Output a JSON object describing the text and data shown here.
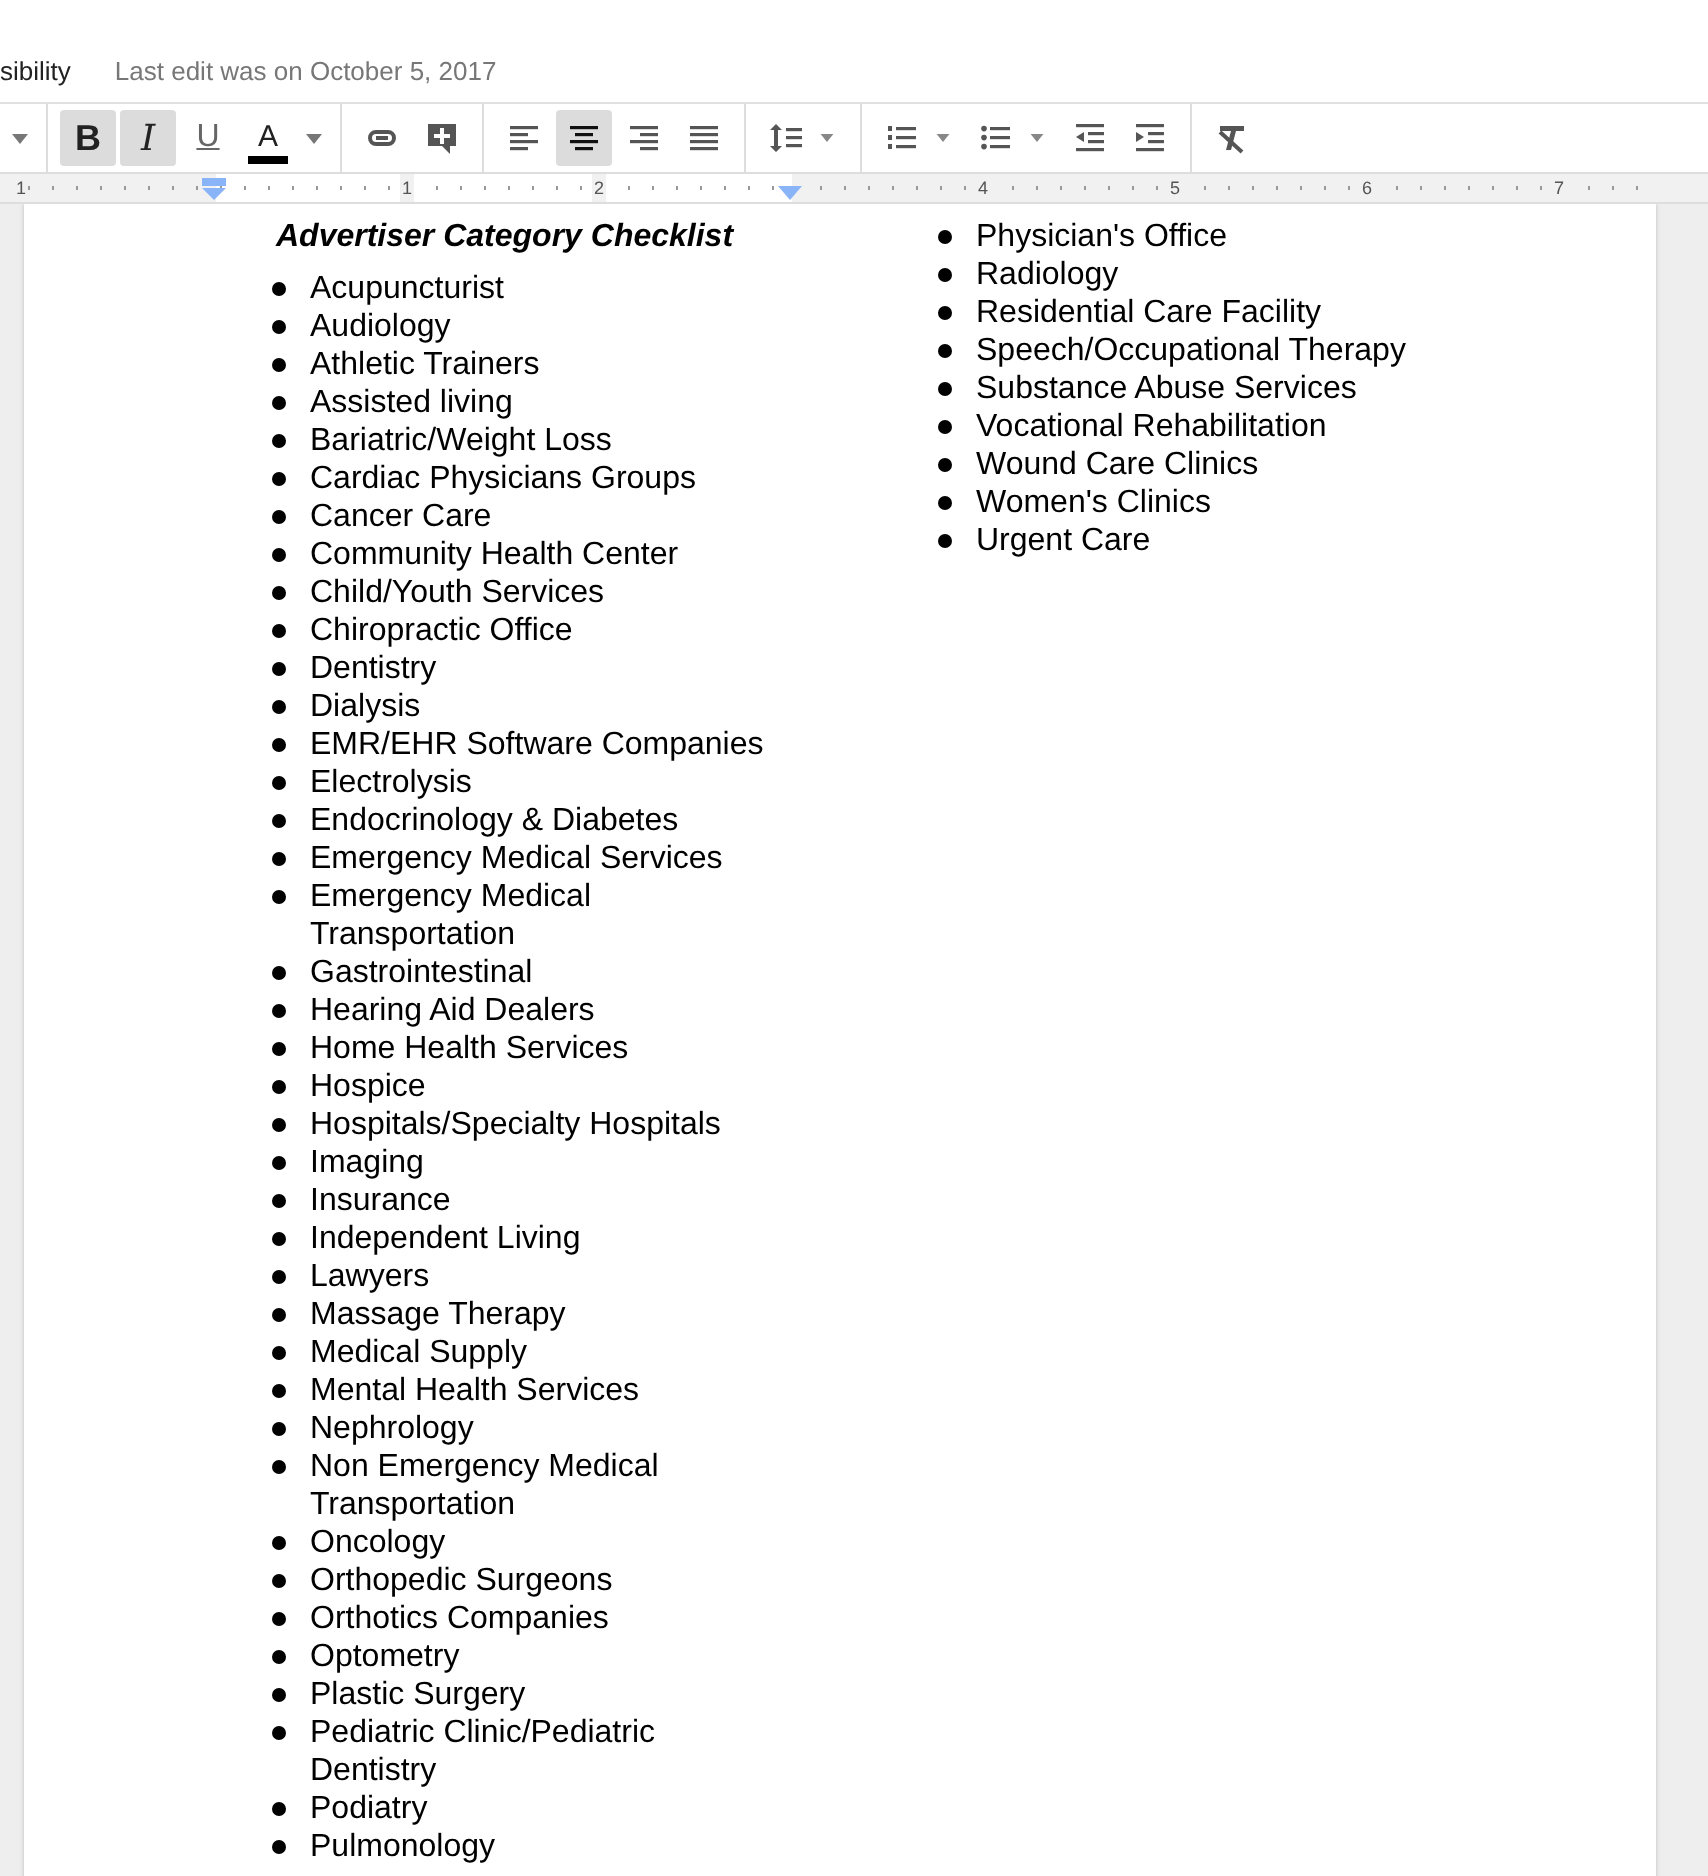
{
  "header": {
    "title": "sibility",
    "last_edit": "Last edit was on October 5, 2017"
  },
  "toolbar": {
    "text_style": [
      {
        "kind": "bold",
        "text": "B",
        "selected": true
      },
      {
        "kind": "italic",
        "text": "I",
        "selected": true
      },
      {
        "kind": "underline",
        "text": "U",
        "selected": false
      },
      {
        "kind": "color",
        "text": "A"
      }
    ],
    "align": [
      {
        "kind": "align-left",
        "selected": false
      },
      {
        "kind": "align-center",
        "selected": true
      },
      {
        "kind": "align-right",
        "selected": false
      },
      {
        "kind": "justify",
        "selected": false
      }
    ]
  },
  "ruler": {
    "labels": [
      "1",
      "1",
      "2",
      "4",
      "5",
      "6",
      "7"
    ]
  },
  "document": {
    "title": "Advertiser Category Checklist",
    "columns": [
      [
        "Acupuncturist",
        "Audiology",
        "Athletic Trainers",
        "Assisted living",
        "Bariatric/Weight Loss",
        "Cardiac Physicians Groups",
        "Cancer Care",
        "Community Health Center",
        "Child/Youth Services",
        "Chiropractic Office",
        "Dentistry",
        "Dialysis",
        "EMR/EHR Software Companies",
        "Electrolysis",
        "Endocrinology & Diabetes",
        "Emergency Medical Services",
        "Emergency Medical Transportation",
        "Gastrointestinal",
        "Hearing Aid Dealers",
        "Home Health Services",
        "Hospice",
        "Hospitals/Specialty Hospitals",
        "Imaging",
        "Insurance",
        "Independent Living",
        "Lawyers",
        "Massage Therapy",
        "Medical Supply",
        "Mental Health Services",
        "Nephrology",
        "Non Emergency Medical Transportation",
        "Oncology",
        "Orthopedic Surgeons",
        "Orthotics Companies",
        "Optometry",
        "Plastic Surgery",
        "Pediatric Clinic/Pediatric Dentistry",
        "Podiatry",
        "Pulmonology"
      ],
      [
        "Physician's Office",
        "Radiology",
        "Residential Care Facility",
        "Speech/Occupational Therapy",
        "Substance Abuse Services",
        "Vocational Rehabilitation",
        "Wound Care Clinics",
        "Women's Clinics",
        "Urgent Care"
      ]
    ]
  }
}
